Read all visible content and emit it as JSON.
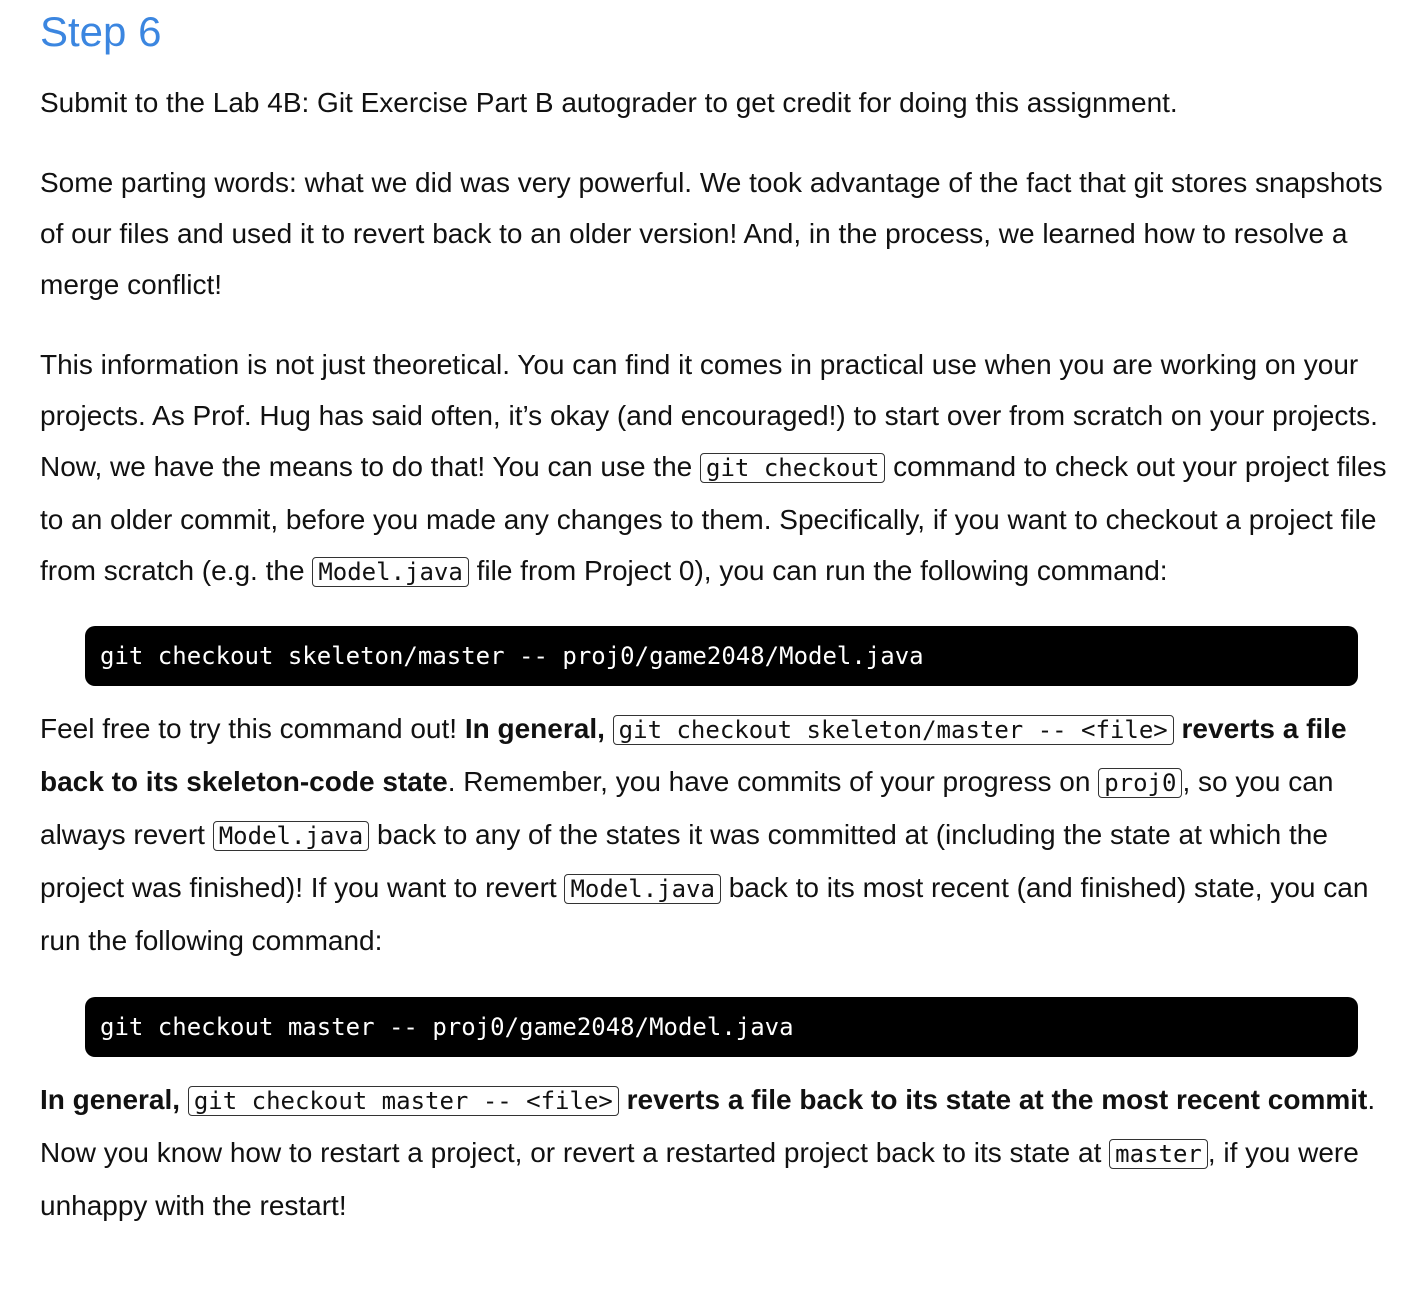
{
  "heading": "Step 6",
  "p1": {
    "text": "Submit to the Lab 4B: Git Exercise Part B autograder to get credit for doing this assignment."
  },
  "p2": {
    "text": "Some parting words: what we did was very powerful. We took advantage of the fact that git stores snapshots of our files and used it to revert back to an older version! And, in the process, we learned how to resolve a merge conflict!"
  },
  "p3": {
    "t1": "This information is not just theoretical. You can find it comes in practical use when you are working on your projects. As Prof. Hug has said often, it’s okay (and encouraged!) to start over from scratch on your projects. Now, we have the means to do that! You can use the ",
    "c1": "git checkout",
    "t2": " command to check out your project files to an older commit, before you made any changes to them. Specifically, if you want to checkout a project file from scratch (e.g. the ",
    "c2": "Model.java",
    "t3": " file from Project 0), you can run the following command:"
  },
  "code1": "git checkout skeleton/master -- proj0/game2048/Model.java",
  "p4": {
    "t1": "Feel free to try this command out! ",
    "b1": "In general, ",
    "c1": "git checkout skeleton/master -- <file>",
    "b2": " reverts a file back to its skeleton-code state",
    "t2": ". Remember, you have commits of your progress on ",
    "c2": "proj0",
    "t3": ", so you can always revert ",
    "c3": "Model.java",
    "t4": " back to any of the states it was committed at (including the state at which the project was finished)! If you want to revert ",
    "c4": "Model.java",
    "t5": " back to its most recent (and finished) state, you can run the following command:"
  },
  "code2": "git checkout master -- proj0/game2048/Model.java",
  "p5": {
    "b1": "In general, ",
    "c1": "git checkout master -- <file>",
    "b2": " reverts a file back to its state at the most recent commit",
    "t1": ". Now you know how to restart a project, or revert a restarted project back to its state at ",
    "c2": "master",
    "t2": ", if you were unhappy with the restart!"
  }
}
